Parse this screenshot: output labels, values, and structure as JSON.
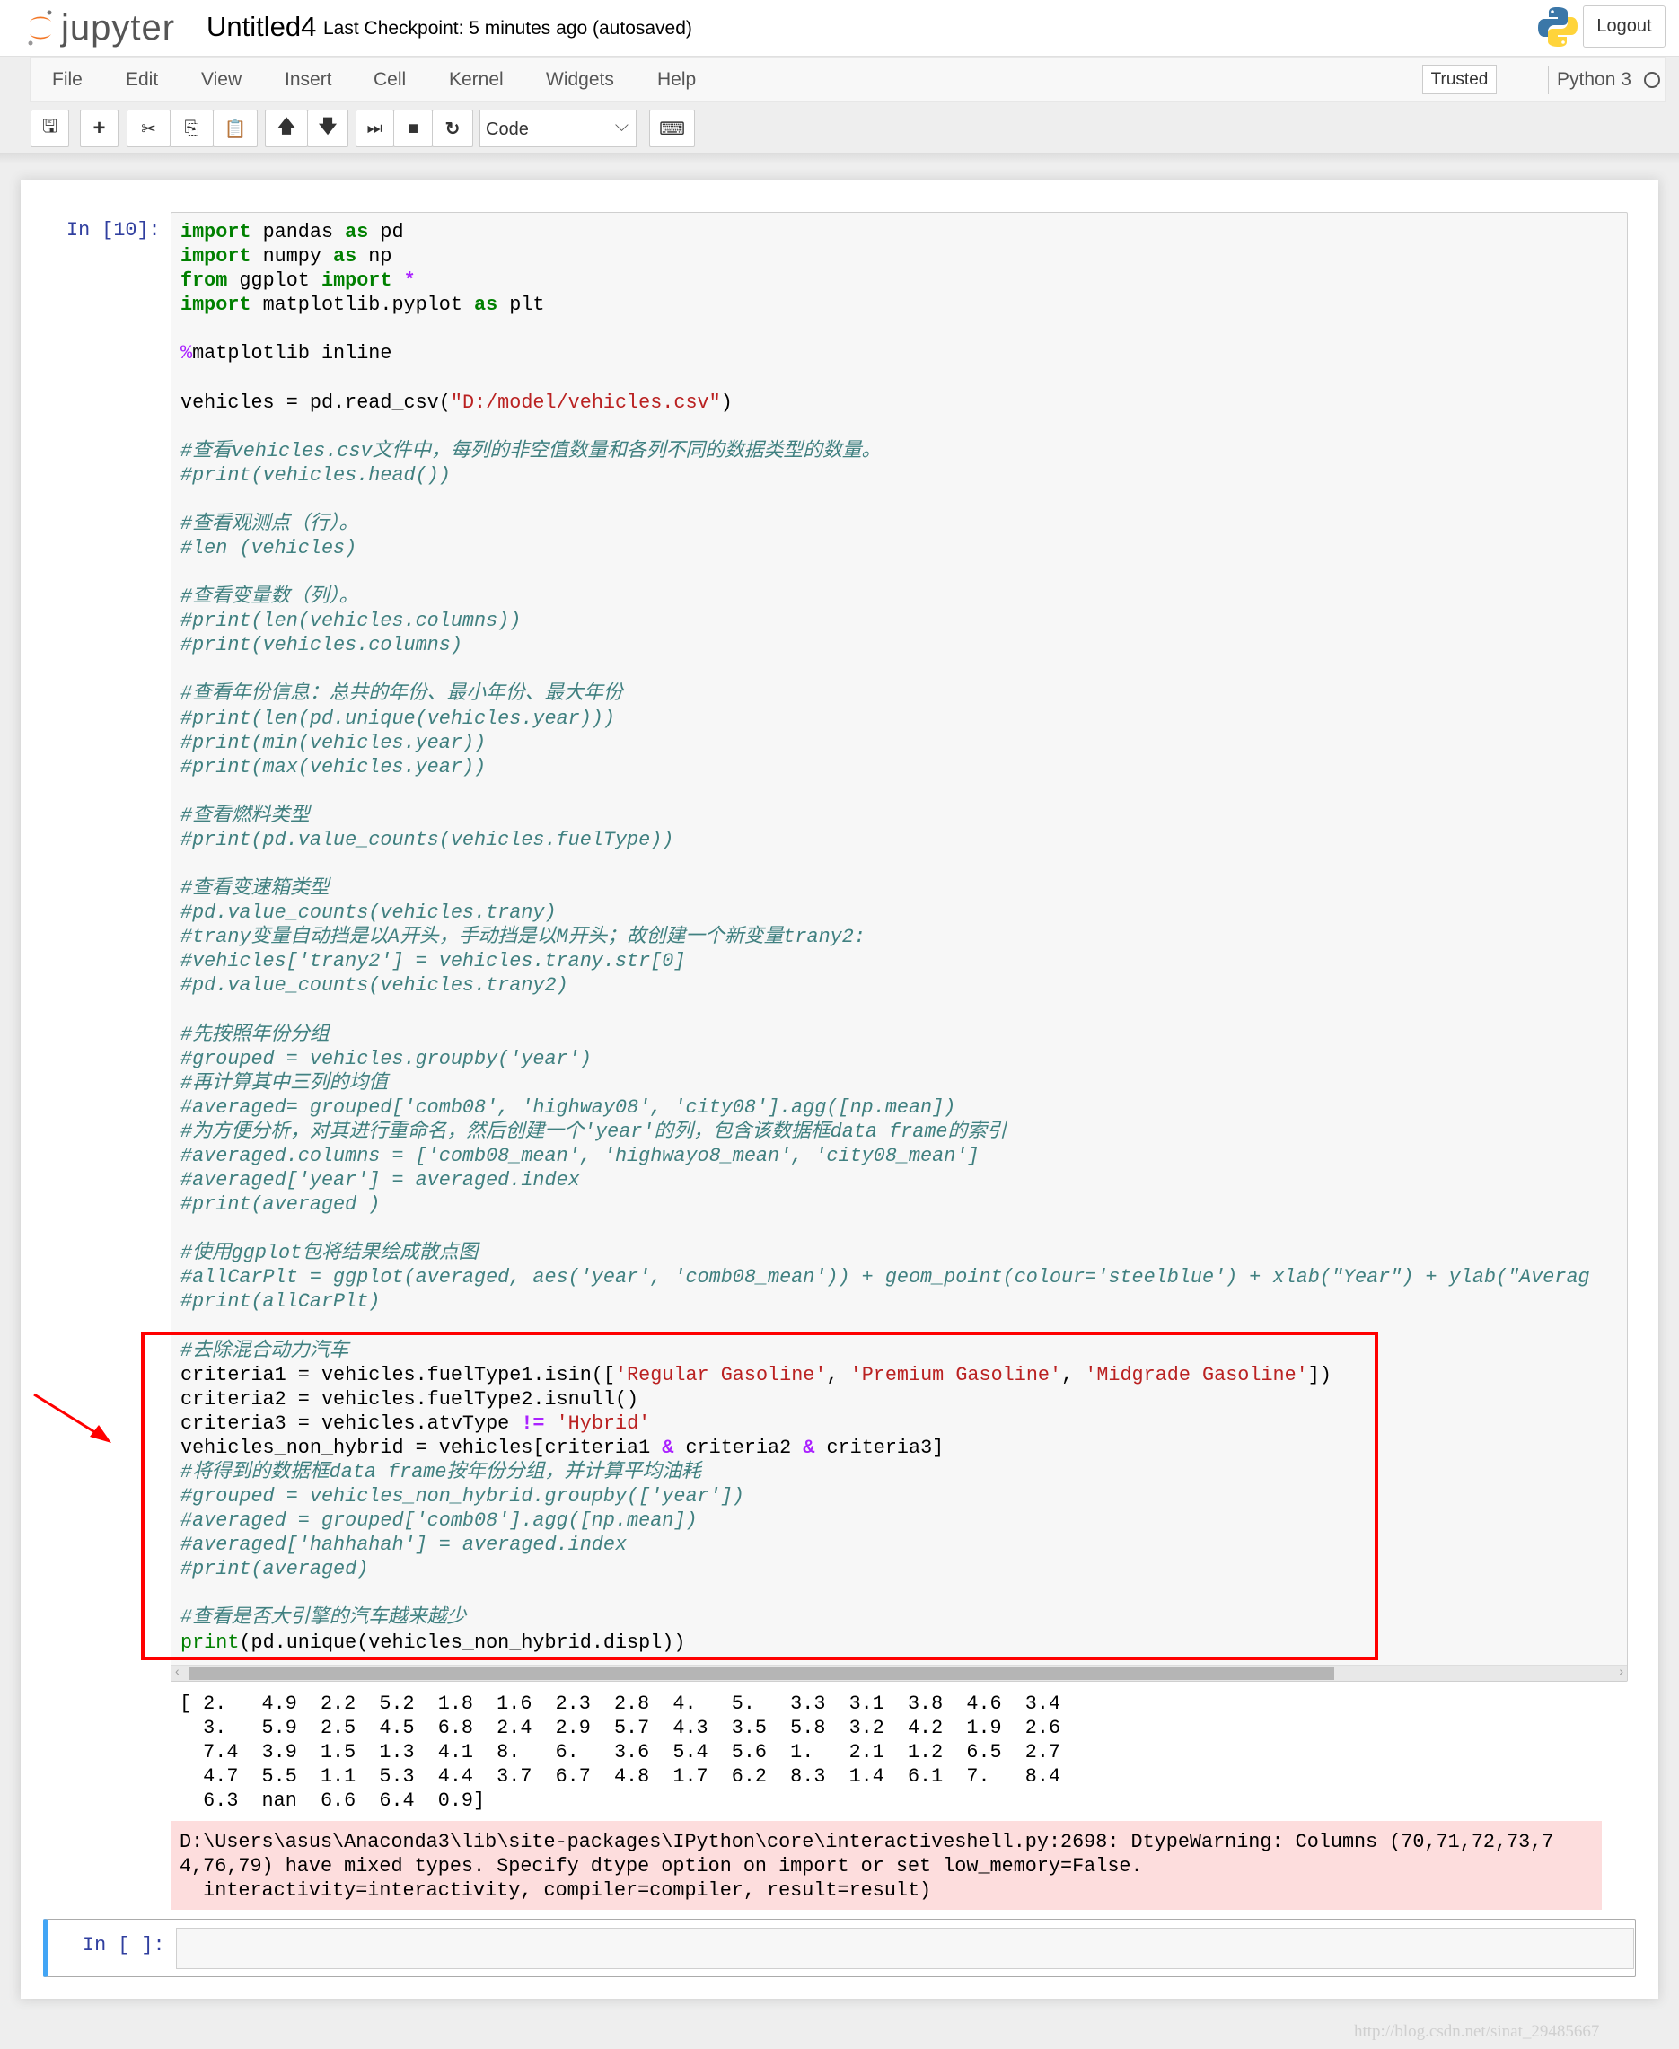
{
  "header": {
    "logo_text": "jupyter",
    "notebook_title": "Untitled4",
    "checkpoint": "Last Checkpoint: 5 minutes ago (autosaved)",
    "logout_label": "Logout"
  },
  "menubar": {
    "items": [
      "File",
      "Edit",
      "View",
      "Insert",
      "Cell",
      "Kernel",
      "Widgets",
      "Help"
    ],
    "trusted_label": "Trusted",
    "kernel_name": "Python 3"
  },
  "toolbar": {
    "buttons": [
      "save-icon",
      "plus-icon",
      "cut-icon",
      "copy-icon",
      "paste-icon",
      "arrow-up-icon",
      "arrow-down-icon",
      "step-forward-icon",
      "stop-icon",
      "restart-icon",
      "keyboard-icon"
    ],
    "cell_type": "Code"
  },
  "cells": [
    {
      "prompt": "In [10]:",
      "code": [
        [
          [
            "k",
            "import"
          ],
          [
            "n",
            " pandas "
          ],
          [
            "k",
            "as"
          ],
          [
            "n",
            " pd"
          ]
        ],
        [
          [
            "k",
            "import"
          ],
          [
            "n",
            " numpy "
          ],
          [
            "k",
            "as"
          ],
          [
            "n",
            " np"
          ]
        ],
        [
          [
            "k",
            "from"
          ],
          [
            "n",
            " ggplot "
          ],
          [
            "k",
            "import"
          ],
          [
            "n",
            " "
          ],
          [
            "o",
            "*"
          ]
        ],
        [
          [
            "k",
            "import"
          ],
          [
            "n",
            " matplotlib.pyplot "
          ],
          [
            "k",
            "as"
          ],
          [
            "n",
            " plt"
          ]
        ],
        [],
        [
          [
            "m",
            "%"
          ],
          [
            "n",
            "matplotlib inline"
          ]
        ],
        [],
        [
          [
            "n",
            "vehicles = pd.read_csv("
          ],
          [
            "s",
            "\"D:/model/vehicles.csv\""
          ],
          [
            "n",
            ")"
          ]
        ],
        [],
        [
          [
            "c",
            "#查看vehicles.csv文件中，每列的非空值数量和各列不同的数据类型的数量。"
          ]
        ],
        [
          [
            "c",
            "#print(vehicles.head())"
          ]
        ],
        [],
        [
          [
            "c",
            "#查看观测点（行）。"
          ]
        ],
        [
          [
            "c",
            "#len (vehicles)"
          ]
        ],
        [],
        [
          [
            "c",
            "#查看变量数（列）。"
          ]
        ],
        [
          [
            "c",
            "#print(len(vehicles.columns))"
          ]
        ],
        [
          [
            "c",
            "#print(vehicles.columns)"
          ]
        ],
        [],
        [
          [
            "c",
            "#查看年份信息：总共的年份、最小年份、最大年份"
          ]
        ],
        [
          [
            "c",
            "#print(len(pd.unique(vehicles.year)))"
          ]
        ],
        [
          [
            "c",
            "#print(min(vehicles.year))"
          ]
        ],
        [
          [
            "c",
            "#print(max(vehicles.year))"
          ]
        ],
        [],
        [
          [
            "c",
            "#查看燃料类型"
          ]
        ],
        [
          [
            "c",
            "#print(pd.value_counts(vehicles.fuelType))"
          ]
        ],
        [],
        [
          [
            "c",
            "#查看变速箱类型"
          ]
        ],
        [
          [
            "c",
            "#pd.value_counts(vehicles.trany)"
          ]
        ],
        [
          [
            "c",
            "#trany变量自动挡是以A开头，手动挡是以M开头；故创建一个新变量trany2:"
          ]
        ],
        [
          [
            "c",
            "#vehicles['trany2'] = vehicles.trany.str[0]"
          ]
        ],
        [
          [
            "c",
            "#pd.value_counts(vehicles.trany2)"
          ]
        ],
        [],
        [
          [
            "c",
            "#先按照年份分组"
          ]
        ],
        [
          [
            "c",
            "#grouped = vehicles.groupby('year')"
          ]
        ],
        [
          [
            "c",
            "#再计算其中三列的均值"
          ]
        ],
        [
          [
            "c",
            "#averaged= grouped['comb08', 'highway08', 'city08'].agg([np.mean])"
          ]
        ],
        [
          [
            "c",
            "#为方便分析，对其进行重命名，然后创建一个'year'的列，包含该数据框data frame的索引"
          ]
        ],
        [
          [
            "c",
            "#averaged.columns = ['comb08_mean', 'highwayo8_mean', 'city08_mean']"
          ]
        ],
        [
          [
            "c",
            "#averaged['year'] = averaged.index"
          ]
        ],
        [
          [
            "c",
            "#print(averaged )"
          ]
        ],
        [],
        [
          [
            "c",
            "#使用ggplot包将结果绘成散点图"
          ]
        ],
        [
          [
            "c",
            "#allCarPlt = ggplot(averaged, aes('year', 'comb08_mean')) + geom_point(colour='steelblue') + xlab(\"Year\") + ylab(\"Averag"
          ]
        ],
        [
          [
            "c",
            "#print(allCarPlt)"
          ]
        ],
        [],
        [
          [
            "c",
            "#去除混合动力汽车"
          ]
        ],
        [
          [
            "n",
            "criteria1 = vehicles.fuelType1.isin(["
          ],
          [
            "s",
            "'Regular Gasoline'"
          ],
          [
            "n",
            ", "
          ],
          [
            "s",
            "'Premium Gasoline'"
          ],
          [
            "n",
            ", "
          ],
          [
            "s",
            "'Midgrade Gasoline'"
          ],
          [
            "n",
            "])"
          ]
        ],
        [
          [
            "n",
            "criteria2 = vehicles.fuelType2.isnull()"
          ]
        ],
        [
          [
            "n",
            "criteria3 = vehicles.atvType "
          ],
          [
            "o",
            "!="
          ],
          [
            "n",
            " "
          ],
          [
            "s",
            "'Hybrid'"
          ]
        ],
        [
          [
            "n",
            "vehicles_non_hybrid = vehicles[criteria1 "
          ],
          [
            "o",
            "&"
          ],
          [
            "n",
            " criteria2 "
          ],
          [
            "o",
            "&"
          ],
          [
            "n",
            " criteria3]"
          ]
        ],
        [
          [
            "c",
            "#将得到的数据框data frame按年份分组，并计算平均油耗"
          ]
        ],
        [
          [
            "c",
            "#grouped = vehicles_non_hybrid.groupby(['year'])"
          ]
        ],
        [
          [
            "c",
            "#averaged = grouped['comb08'].agg([np.mean])"
          ]
        ],
        [
          [
            "c",
            "#averaged['hahhahah'] = averaged.index"
          ]
        ],
        [
          [
            "c",
            "#print(averaged)"
          ]
        ],
        [],
        [
          [
            "c",
            "#查看是否大引擎的汽车越来越少"
          ]
        ],
        [
          [
            "b",
            "print"
          ],
          [
            "n",
            "(pd.unique(vehicles_non_hybrid.displ))"
          ]
        ]
      ],
      "output": [
        "[ 2.   4.9  2.2  5.2  1.8  1.6  2.3  2.8  4.   5.   3.3  3.1  3.8  4.6  3.4",
        "  3.   5.9  2.5  4.5  6.8  2.4  2.9  5.7  4.3  3.5  5.8  3.2  4.2  1.9  2.6",
        "  7.4  3.9  1.5  1.3  4.1  8.   6.   3.6  5.4  5.6  1.   2.1  1.2  6.5  2.7",
        "  4.7  5.5  1.1  5.3  4.4  3.7  6.7  4.8  1.7  6.2  8.3  1.4  6.1  7.   8.4",
        "  6.3  nan  6.6  6.4  0.9]"
      ],
      "stderr": [
        "D:\\Users\\asus\\Anaconda3\\lib\\site-packages\\IPython\\core\\interactiveshell.py:2698: DtypeWarning: Columns (70,71,72,73,7",
        "4,76,79) have mixed types. Specify dtype option on import or set low_memory=False.",
        "  interactivity=interactivity, compiler=compiler, result=result)"
      ]
    },
    {
      "prompt": "In [ ]:",
      "code": []
    }
  ],
  "annotation": {
    "highlight_color": "#ff0000"
  },
  "watermark": "http://blog.csdn.net/sinat_29485667",
  "colors": {
    "keyword": "#008000",
    "string": "#BA2121",
    "comment": "#408080",
    "operator": "#AA22FF",
    "prompt": "#303F9F",
    "selected_cell": "#42A5F5",
    "stderr_bg": "#fddddd"
  }
}
